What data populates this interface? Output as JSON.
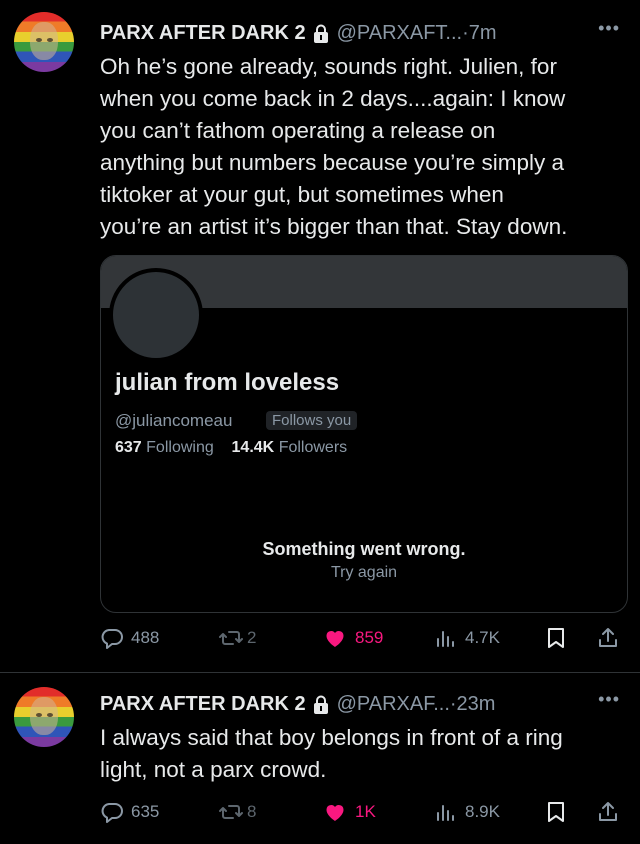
{
  "tweets": [
    {
      "author_name": "PARX AFTER DARK 2",
      "handle": "@PARXAFT...",
      "time": "7m",
      "text": "Oh he’s gone already, sounds right. Julien, for\nwhen you come back in 2 days....again: I know\nyou can’t fathom operating a release on\nanything but numbers because you’re simply a\ntiktoker at your gut, but sometimes when\nyou’re an artist it’s bigger than that. Stay down.",
      "card": {
        "name": "julian from loveless",
        "handle": "@juliancomeau",
        "follows_badge": "Follows you",
        "following_count": "637",
        "following_label": "Following",
        "followers_count": "14.4K",
        "followers_label": "Followers",
        "error_title": "Something went wrong.",
        "error_retry": "Try again"
      },
      "replies": "488",
      "reposts": "2",
      "likes": "859",
      "views": "4.7K"
    },
    {
      "author_name": "PARX AFTER DARK 2",
      "handle": "@PARXAF...",
      "time": "23m",
      "text": "I always said that boy belongs in front of a ring\nlight, not a parx crowd.",
      "replies": "635",
      "reposts": "8",
      "likes": "1K",
      "views": "8.9K"
    }
  ],
  "separator": "·",
  "colors": {
    "background": "#000000",
    "text": "#e7e9ea",
    "muted": "#8b98a5",
    "like": "#f91880",
    "border": "#2f3336"
  },
  "icons": [
    "lock-icon",
    "more-icon",
    "reply-icon",
    "repost-icon",
    "heart-icon",
    "views-icon",
    "bookmark-icon",
    "share-icon"
  ]
}
